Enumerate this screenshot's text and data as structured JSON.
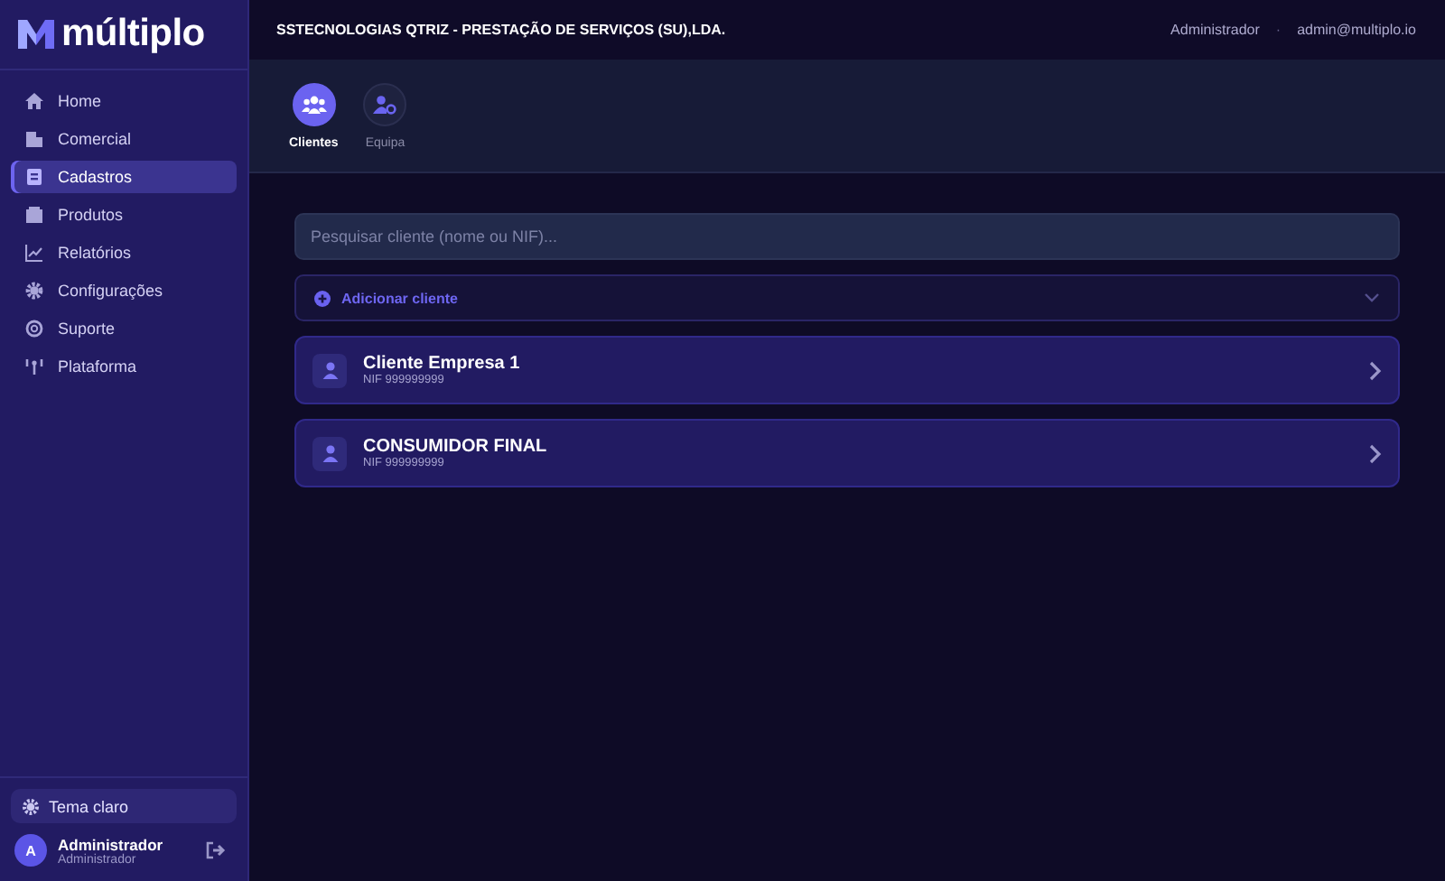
{
  "brand": "múltiplo",
  "nav": [
    {
      "label": "Home",
      "selected": false
    },
    {
      "label": "Comercial",
      "selected": false
    },
    {
      "label": "Cadastros",
      "selected": true
    },
    {
      "label": "Produtos",
      "selected": false
    },
    {
      "label": "Relatórios",
      "selected": false
    },
    {
      "label": "Configurações",
      "selected": false
    },
    {
      "label": "Suporte",
      "selected": false
    },
    {
      "label": "Plataforma",
      "selected": false
    }
  ],
  "theme_button": "Tema claro",
  "user": {
    "initial": "A",
    "name": "Administrador",
    "role": "Administrador"
  },
  "header": {
    "company": "SSTECNOLOGIAS QTRIZ - PRESTAÇÃO DE SERVIÇOS (SU),LDA.",
    "role": "Administrador",
    "separator": "·",
    "email": "admin@multiplo.io"
  },
  "tabs": [
    {
      "label": "Clientes",
      "selected": true
    },
    {
      "label": "Equipa",
      "selected": false
    }
  ],
  "search": {
    "placeholder": "Pesquisar cliente (nome ou NIF)..."
  },
  "add_client": {
    "label": "Adicionar cliente",
    "expanded": false
  },
  "clients": [
    {
      "name": "Cliente Empresa 1",
      "nif": "NIF 999999999"
    },
    {
      "name": "CONSUMIDOR FINAL",
      "nif": "NIF 999999999"
    }
  ]
}
